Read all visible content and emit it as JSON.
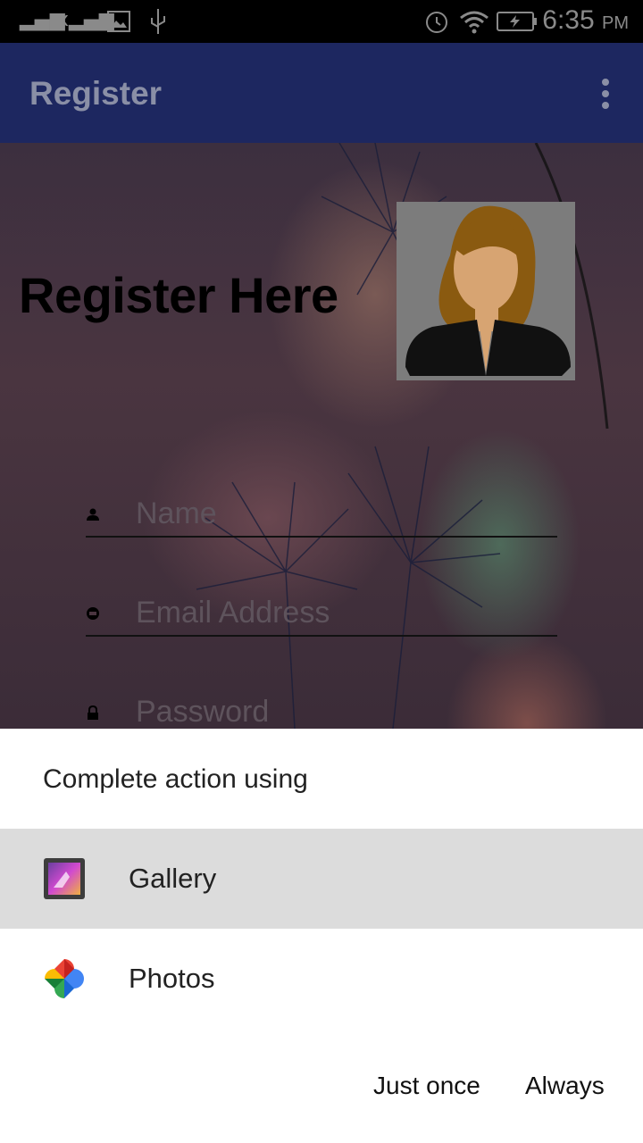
{
  "status_bar": {
    "time": "6:35",
    "ampm": "PM"
  },
  "app_bar": {
    "title": "Register"
  },
  "form": {
    "heading": "Register Here",
    "name_placeholder": "Name",
    "email_placeholder": "Email Address",
    "password_placeholder": "Password"
  },
  "chooser": {
    "title": "Complete action using",
    "options": [
      {
        "label": "Gallery",
        "icon": "gallery-icon",
        "selected": true
      },
      {
        "label": "Photos",
        "icon": "photos-icon",
        "selected": false
      }
    ],
    "just_once_label": "Just once",
    "always_label": "Always"
  },
  "colors": {
    "app_bar": "#1d2760",
    "selected_row": "#dcdcdc",
    "sheet_bg": "#ffffff"
  }
}
